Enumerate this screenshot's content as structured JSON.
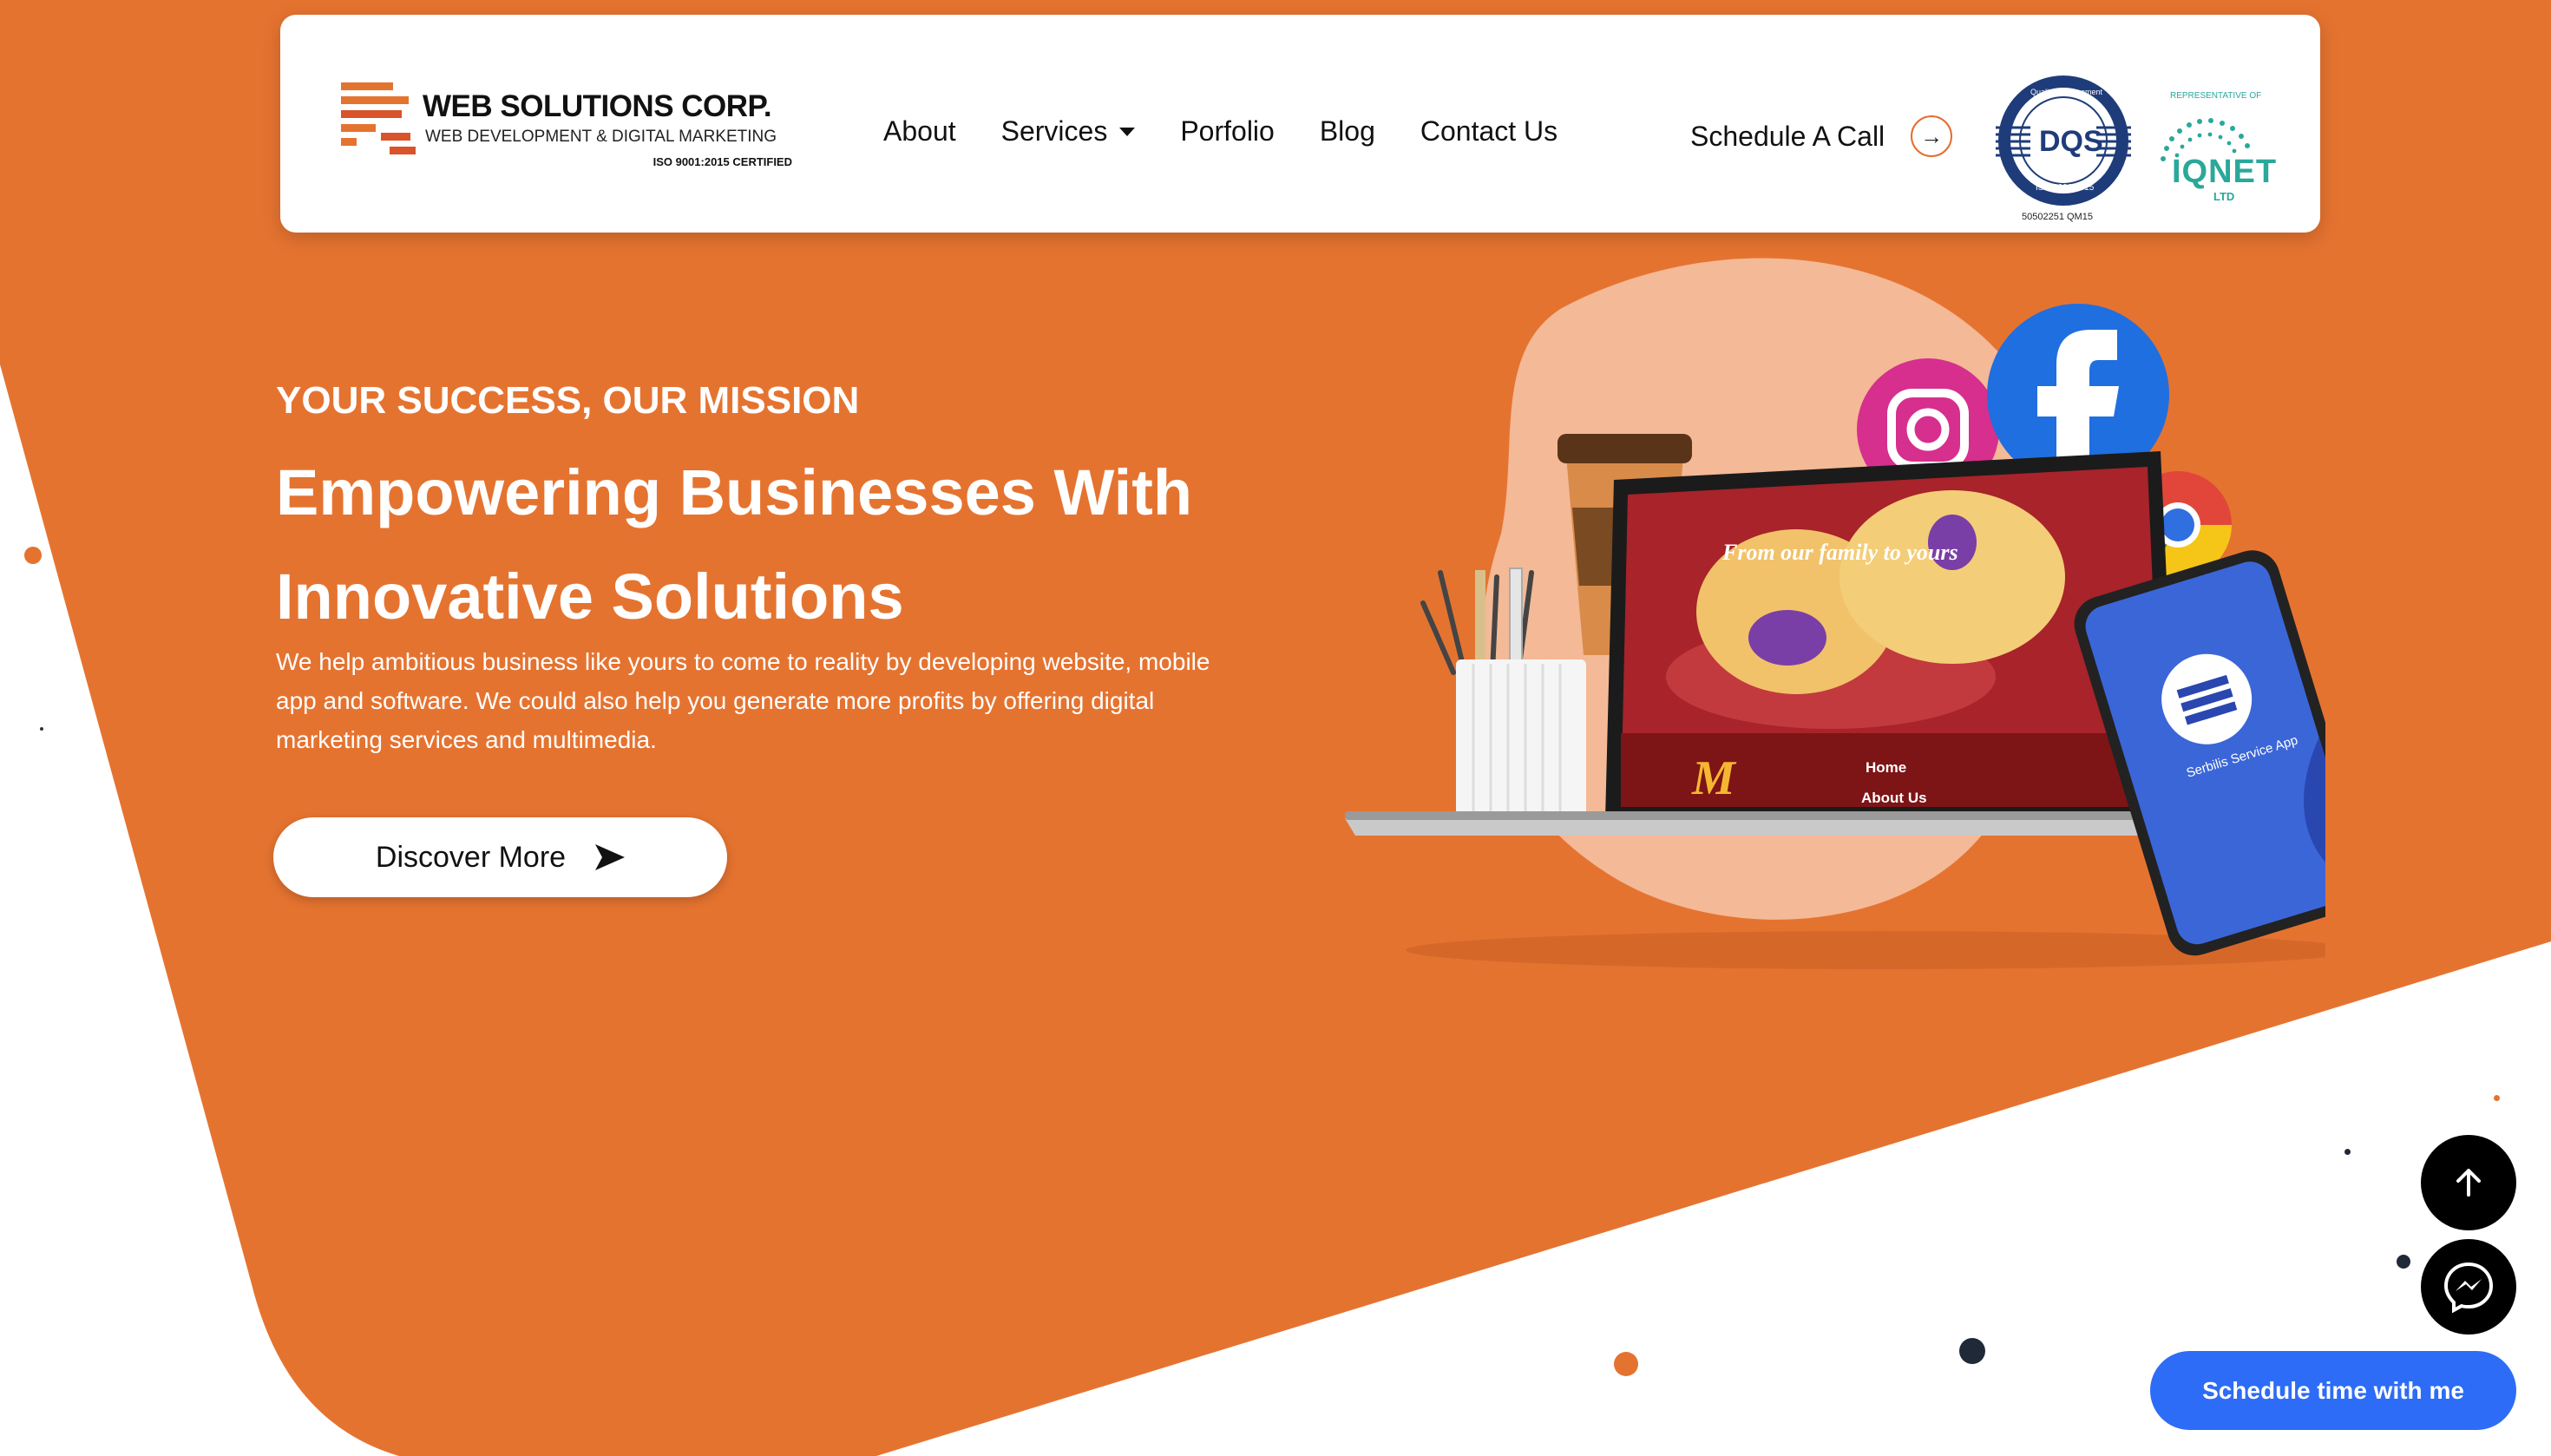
{
  "colors": {
    "brand_orange": "#e57330",
    "blob_peach": "#f4b996",
    "white": "#ffffff",
    "dark": "#111111",
    "schedule_button_blue": "#2d6cf6"
  },
  "header": {
    "logo": {
      "name": "WEB SOLUTIONS CORP.",
      "tagline": "WEB DEVELOPMENT & DIGITAL MARKETING",
      "certification": "ISO 9001:2015 CERTIFIED"
    },
    "nav": [
      {
        "label": "About"
      },
      {
        "label": "Services"
      },
      {
        "label": "Porfolio"
      },
      {
        "label": "Blog"
      },
      {
        "label": "Contact Us"
      }
    ],
    "schedule_call": "Schedule A Call",
    "badges": {
      "dqs_top": "Quality Management",
      "dqs_mid": "DQS",
      "dqs_bottom": "ISO 9001:2015",
      "dqs_number": "50502251 QM15",
      "iqnet_rep": "REPRESENTATIVE OF",
      "iqnet_name": "IQNET",
      "iqnet_ltd": "LTD"
    }
  },
  "hero": {
    "kicker": "YOUR SUCCESS, OUR MISSION",
    "title": "Empowering Businesses With Innovative Solutions",
    "description": "We help ambitious business like yours to come to reality by developing website, mobile app and software. We could also help you generate more profits by offering digital marketing services and multimedia.",
    "cta": "Discover More",
    "art": {
      "laptop_headline": "From our family to yours",
      "laptop_menu_home": "Home",
      "laptop_menu_about": "About Us",
      "phone_app": "Serbilis Service App"
    }
  },
  "floating": {
    "back_to_top_icon": "arrow-up-icon",
    "messenger_icon": "messenger-icon",
    "schedule_me": "Schedule time with me"
  }
}
